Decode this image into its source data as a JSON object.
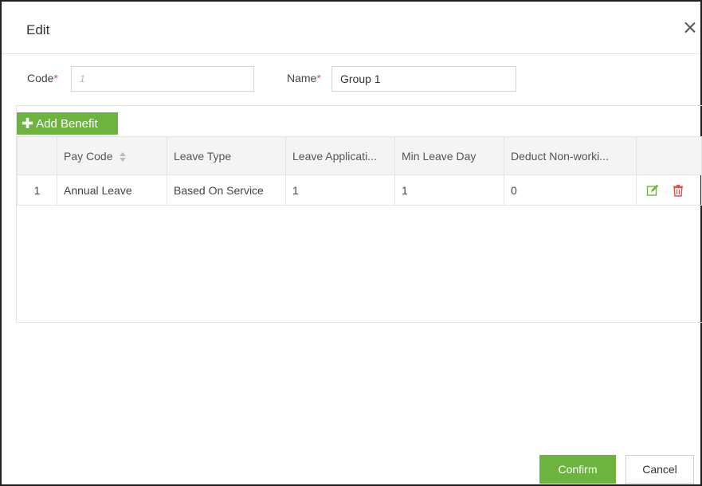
{
  "dialog": {
    "title": "Edit"
  },
  "form": {
    "code_label": "Code",
    "code_placeholder": "1",
    "code_value": "",
    "name_label": "Name",
    "name_value": "Group 1",
    "required_mark": "*"
  },
  "toolbar": {
    "add_label": "Add Benefit",
    "add_icon": "plus-icon"
  },
  "table": {
    "columns": [
      "",
      "Pay Code",
      "Leave Type",
      "Leave Applicati...",
      "Min Leave Day",
      "Deduct Non-worki...",
      ""
    ],
    "rows": [
      {
        "index": "1",
        "pay_code": "Annual Leave",
        "leave_type": "Based On Service",
        "leave_application": "1",
        "min_leave_day": "1",
        "deduct_non_working": "0"
      }
    ]
  },
  "footer": {
    "confirm_label": "Confirm",
    "cancel_label": "Cancel"
  },
  "colors": {
    "accent_green": "#6cb33f",
    "delete_red": "#d9534f",
    "required_red": "#d9534f"
  }
}
